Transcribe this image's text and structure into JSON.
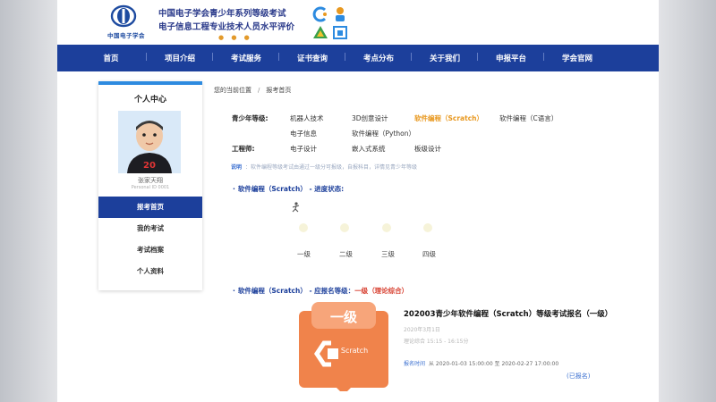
{
  "header": {
    "logo_text": "中国电子学会",
    "title_line1": "中国电子学会青少年系列等级考试",
    "title_line2": "电子信息工程专业技术人员水平评价",
    "dots": "● ● ●"
  },
  "nav": [
    {
      "label": "首页"
    },
    {
      "label": "项目介绍"
    },
    {
      "label": "考试服务"
    },
    {
      "label": "证书查询"
    },
    {
      "label": "考点分布"
    },
    {
      "label": "关于我们"
    },
    {
      "label": "申报平台"
    },
    {
      "label": "学会官网"
    }
  ],
  "sidebar": {
    "title": "个人中心",
    "avatar_number": "20",
    "user_name": "张家天翔",
    "user_sub": "Personal ID 0001",
    "menu": [
      {
        "label": "报考首页",
        "active": true
      },
      {
        "label": "我的考试",
        "active": false
      },
      {
        "label": "考试档案",
        "active": false
      },
      {
        "label": "个人资料",
        "active": false
      }
    ]
  },
  "breadcrumb": {
    "prefix": "您的当前位置",
    "sep": "/",
    "current": "报考首页"
  },
  "categories": {
    "youth_label": "青少年等级:",
    "youth_row1": [
      "机器人技术",
      "3D创意设计",
      "软件编程（Scratch）",
      "软件编程（C语言）"
    ],
    "youth_row2": [
      "电子信息",
      "软件编程（Python）"
    ],
    "engineer_label": "工程师:",
    "engineer_row": [
      "电子设计",
      "嵌入式系统",
      "板级设计"
    ],
    "selected": "软件编程（Scratch）"
  },
  "note": {
    "label": "说明",
    "text": "：软件编程等级考试由通过一级分可报级，自报科目，详情见青少年等级"
  },
  "progress": {
    "heading_subject": "软件编程（Scratch）",
    "heading_suffix": " - 进度状态:",
    "levels": [
      "一级",
      "二级",
      "三级",
      "四级"
    ]
  },
  "apply": {
    "heading_subject": "软件编程（Scratch）",
    "heading_mid": " - 应报名等级：",
    "heading_level": "一级",
    "heading_note": "（理论综合）"
  },
  "card": {
    "badge": "一级",
    "brand": "Scratch",
    "title": "202003青少年软件编程（Scratch）等级考试报名（一级）",
    "line1": "2020年3月1日",
    "line2": "理论综合 15:15 - 16:15分",
    "time_label": "报名时间",
    "time_value": "从 2020-01-03 15:00:00 至 2020-02-27 17:00:00",
    "status": "(已报名)"
  },
  "colors": {
    "nav_bg": "#1c3f9b",
    "selected": "#e8981f",
    "accent_blue": "#2d8be0",
    "card_orange": "#f0834b"
  }
}
